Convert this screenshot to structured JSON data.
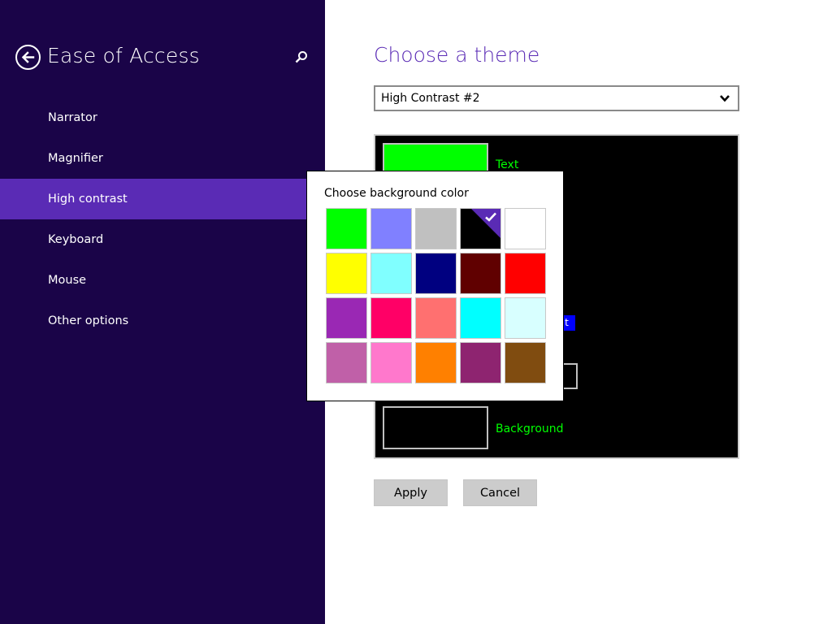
{
  "sidebar": {
    "title": "Ease of Access",
    "items": [
      {
        "label": "Narrator"
      },
      {
        "label": "Magnifier"
      },
      {
        "label": "High contrast"
      },
      {
        "label": "Keyboard"
      },
      {
        "label": "Mouse"
      },
      {
        "label": "Other options"
      }
    ],
    "selected_index": 2,
    "icons": {
      "back": "back-arrow-icon",
      "search": "search-icon"
    }
  },
  "main": {
    "title": "Choose a theme",
    "theme_select": {
      "value": "High Contrast #2",
      "icon": "chevron-down-icon"
    },
    "preview": {
      "text_label": "Text",
      "background_label": "Background",
      "partial_label": "t"
    },
    "apply_label": "Apply",
    "cancel_label": "Cancel"
  },
  "popup": {
    "title": "Choose background color",
    "selected_index": 3,
    "colors": [
      "#00ff00",
      "#8080ff",
      "#c0c0c0",
      "#000000",
      "#ffffff",
      "#ffff00",
      "#80ffff",
      "#000080",
      "#600000",
      "#ff0000",
      "#9a28b4",
      "#ff0066",
      "#ff7070",
      "#00ffff",
      "#d8ffff",
      "#c060a8",
      "#ff78cc",
      "#ff8000",
      "#8e2470",
      "#804c10"
    ]
  },
  "colors": {
    "sidebar_bg": "#1a0448",
    "accent": "#5a2bb5",
    "preview_text": "#00ff00",
    "preview_bg": "#000000"
  }
}
